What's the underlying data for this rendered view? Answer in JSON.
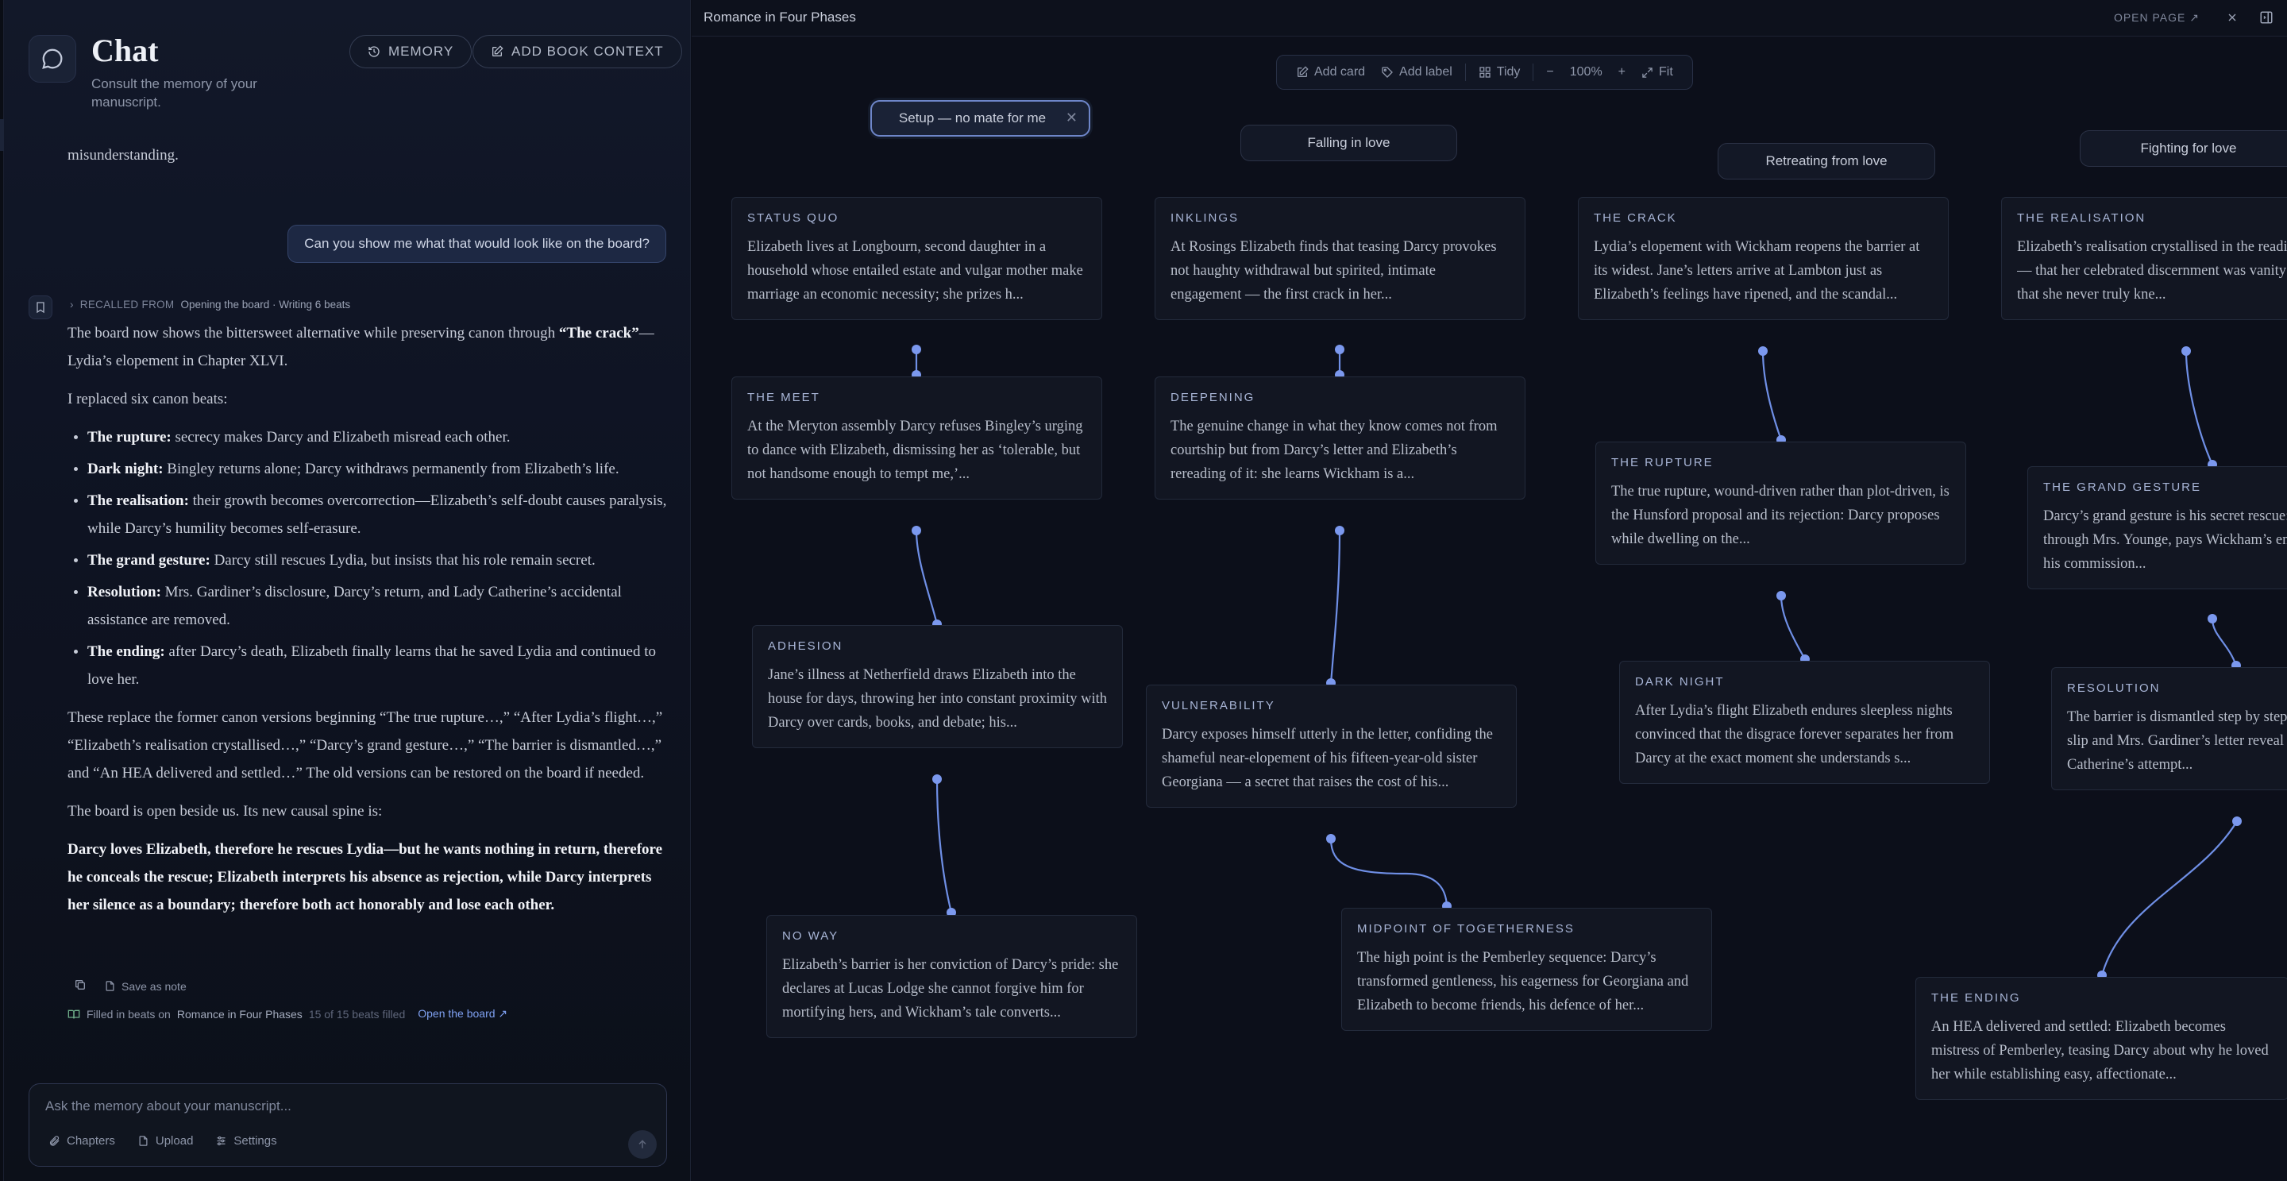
{
  "chat": {
    "title": "Chat",
    "subtitle": "Consult the memory of your manuscript.",
    "memory_label": "MEMORY",
    "add_context_label": "ADD BOOK CONTEXT",
    "prev_text": "misunderstanding.",
    "user_message": "Can you show me what that would look like on the board?",
    "recalled_label": "RECALLED FROM",
    "recalled_source": "Opening the board · Writing 6 beats",
    "answer": {
      "p1_a": "The board now shows the bittersweet alternative while preserving canon through ",
      "p1_b": "“The crack”",
      "p1_c": "—Lydia’s elopement in Chapter XLVI.",
      "p2": "I replaced six canon beats:",
      "bullets": [
        {
          "term": "The rupture:",
          "text": " secrecy makes Darcy and Elizabeth misread each other."
        },
        {
          "term": "Dark night:",
          "text": " Bingley returns alone; Darcy withdraws permanently from Elizabeth’s life."
        },
        {
          "term": "The realisation:",
          "text": " their growth becomes overcorrection—Elizabeth’s self-doubt causes paralysis, while Darcy’s humility becomes self-erasure."
        },
        {
          "term": "The grand gesture:",
          "text": " Darcy still rescues Lydia, but insists that his role remain secret."
        },
        {
          "term": "Resolution:",
          "text": " Mrs. Gardiner’s disclosure, Darcy’s return, and Lady Catherine’s accidental assistance are removed."
        },
        {
          "term": "The ending:",
          "text": " after Darcy’s death, Elizabeth finally learns that he saved Lydia and continued to love her."
        }
      ],
      "p3": "These replace the former canon versions beginning “The true rupture…,” “After Lydia’s flight…,” “Elizabeth’s realisation crystallised…,” “Darcy’s grand gesture…,” “The barrier is dismantled…,” and “An HEA delivered and settled…” The old versions can be restored on the board if needed.",
      "p4": "The board is open beside us. Its new causal spine is:",
      "p5": "Darcy loves Elizabeth, therefore he rescues Lydia—but he wants nothing in return, therefore he conceals the rescue; Elizabeth interprets his absence as rejection, while Darcy interprets her silence as a boundary; therefore both act honorably and lose each other."
    },
    "save_note_label": "Save as note",
    "filled_prefix": "Filled in beats on",
    "filled_book": "Romance in Four Phases",
    "filled_count": "15 of 15 beats filled",
    "open_board_label": "Open the board ↗",
    "composer_placeholder": "Ask the memory about your manuscript...",
    "tools": {
      "chapters": "Chapters",
      "upload": "Upload",
      "settings": "Settings"
    }
  },
  "board": {
    "title": "Romance in Four Phases",
    "open_page_label": "OPEN PAGE ↗",
    "toolbar": {
      "add_card": "Add card",
      "add_label": "Add label",
      "tidy": "Tidy",
      "zoom": "100%",
      "fit": "Fit"
    },
    "phases": [
      "Setup — no mate for me",
      "Falling in love",
      "Retreating from love",
      "Fighting for love"
    ],
    "cards": [
      {
        "label": "STATUS QUO",
        "text": "Elizabeth lives at Longbourn, second daughter in a household whose entailed estate and vulgar mother make marriage an economic necessity; she prizes h..."
      },
      {
        "label": "THE MEET",
        "text": "At the Meryton assembly Darcy refuses Bingley’s urging to dance with Elizabeth, dismissing her as ‘tolerable, but not handsome enough to tempt me,’..."
      },
      {
        "label": "ADHESION",
        "text": "Jane’s illness at Netherfield draws Elizabeth into the house for days, throwing her into constant proximity with Darcy over cards, books, and debate; his..."
      },
      {
        "label": "NO WAY",
        "text": "Elizabeth’s barrier is her conviction of Darcy’s pride: she declares at Lucas Lodge she cannot forgive him for mortifying hers, and Wickham’s tale converts..."
      },
      {
        "label": "INKLINGS",
        "text": "At Rosings Elizabeth finds that teasing Darcy provokes not haughty withdrawal but spirited, intimate engagement — the first crack in her..."
      },
      {
        "label": "DEEPENING",
        "text": "The genuine change in what they know comes not from courtship but from Darcy’s letter and Elizabeth’s rereading of it: she learns Wickham is a..."
      },
      {
        "label": "VULNERABILITY",
        "text": "Darcy exposes himself utterly in the letter, confiding the shameful near-elopement of his fifteen-year-old sister Georgiana — a secret that raises the cost of his..."
      },
      {
        "label": "MIDPOINT OF TOGETHERNESS",
        "text": "The high point is the Pemberley sequence: Darcy’s transformed gentleness, his eagerness for Georgiana and Elizabeth to become friends, his defence of her..."
      },
      {
        "label": "THE CRACK",
        "text": "Lydia’s elopement with Wickham reopens the barrier at its widest. Jane’s letters arrive at Lambton just as Elizabeth’s feelings have ripened, and the scandal..."
      },
      {
        "label": "THE RUPTURE",
        "text": "The true rupture, wound-driven rather than plot-driven, is the Hunsford proposal and its rejection: Darcy proposes while dwelling on the..."
      },
      {
        "label": "DARK NIGHT",
        "text": "After Lydia’s flight Elizabeth endures sleepless nights convinced that the disgrace forever separates her from Darcy at the exact moment she understands s..."
      },
      {
        "label": "THE ENDING",
        "text": "An HEA delivered and settled: Elizabeth becomes mistress of Pemberley, teasing Darcy about why he loved her while establishing easy, affectionate..."
      },
      {
        "label": "THE REALISATION",
        "text": "Elizabeth’s realisation crystallised in the reading of the letter — that her celebrated discernment was vanity and delusion, that she never truly kne..."
      },
      {
        "label": "THE GRAND GESTURE",
        "text": "Darcy’s grand gesture is his secret rescue: he tracks the couple through Mrs. Younge, pays Wickham’s enormous debts, buys his commission..."
      },
      {
        "label": "RESOLUTION",
        "text": "The barrier is dismantled step by step, stripped away: Lydia’s slip and Mrs. Gardiner’s letter reveal Darcy’s agency; Lady Catherine’s attempt..."
      }
    ]
  }
}
